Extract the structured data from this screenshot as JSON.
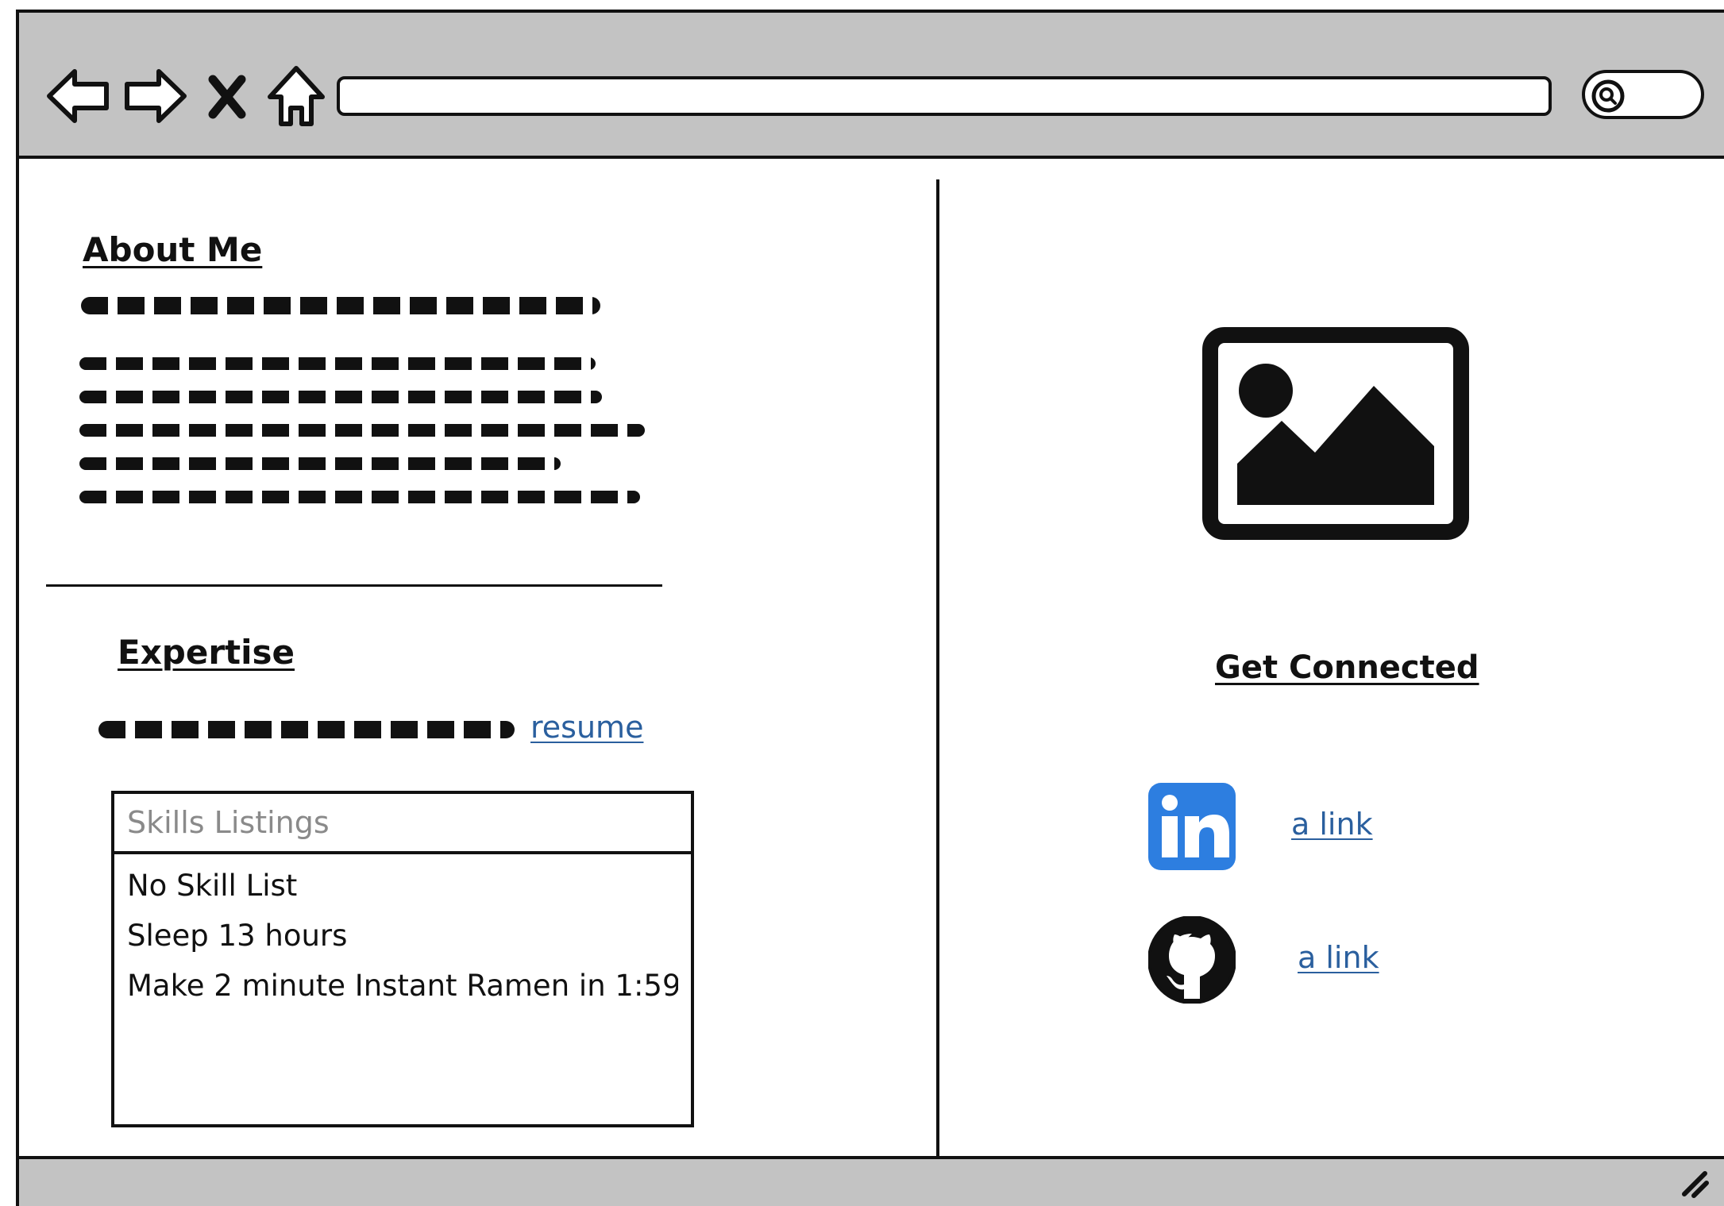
{
  "browser": {
    "nav_icons": [
      "back-arrow-icon",
      "forward-arrow-icon",
      "close-icon",
      "home-icon"
    ],
    "address": "",
    "search_icon": "search-icon"
  },
  "about": {
    "heading": "About Me"
  },
  "expertise": {
    "heading": "Expertise",
    "resume_link": "resume"
  },
  "skills": {
    "header": "Skills Listings",
    "items": [
      "No Skill List",
      "Sleep 13 hours",
      "Make 2 minute Instant Ramen in 1:59"
    ]
  },
  "connect": {
    "heading": "Get Connected",
    "links": [
      {
        "icon": "linkedin-icon",
        "label": "a link",
        "color": "#2d7ee0"
      },
      {
        "icon": "github-icon",
        "label": "a link",
        "color": "#111111"
      }
    ]
  },
  "colors": {
    "chrome": "#c3c3c3",
    "link": "#2a5f9e"
  }
}
